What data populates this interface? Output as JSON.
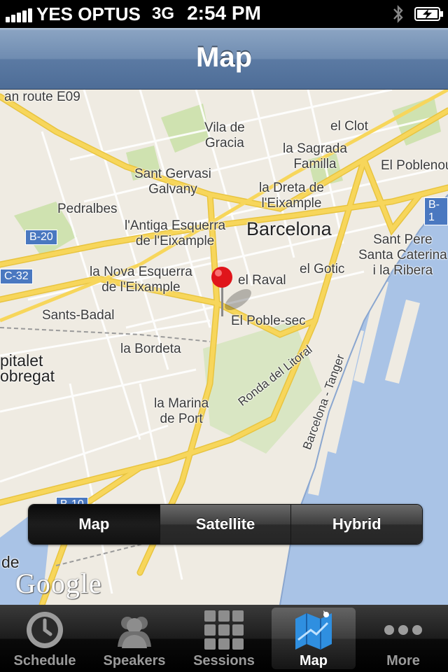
{
  "status_bar": {
    "carrier": "YES OPTUS",
    "network": "3G",
    "time": "2:54 PM",
    "icons": [
      "signal-icon",
      "bluetooth-icon",
      "battery-charging-icon"
    ]
  },
  "nav_bar": {
    "title": "Map"
  },
  "map": {
    "labels": {
      "vila_de_gracia": "Vila de\nGracia",
      "el_clot": "el Clot",
      "la_sagrada_familia": "la Sagrada\nFamilla",
      "el_poblenou": "El Poblenou",
      "sant_gervasi": "Sant Gervasi\nGalvany",
      "la_dreta": "la Dreta de\nl'Eixample",
      "pedralbes": "Pedralbes",
      "antiga_esquerra": "l'Antiga Esquerra\nde l'Eixample",
      "barcelona": "Barcelona",
      "sant_pere": "Sant Pere\nSanta Caterina\ni la Ribera",
      "nova_esquerra": "la Nova Esquerra\nde l'Eixample",
      "el_raval": "el Raval",
      "el_gotic": "el Gotic",
      "sants_badal": "Sants-Badal",
      "el_poble_sec": "El Poble-sec",
      "la_bordeta": "la Bordeta",
      "hospitalet": "pitalet\nobregat",
      "la_marina": "la Marina\nde Port",
      "ronda_litoral": "Ronda del Litoral",
      "barcelona_tanger": "Barcelona - Tanger",
      "route_e09": "an route E09",
      "de": "de"
    },
    "shields": {
      "b20": "B-20",
      "c32": "C-32",
      "b10": "B-10",
      "b1": "B-1"
    },
    "attribution": "Google",
    "pin_icon": "map-pin-icon"
  },
  "segmented_control": {
    "options": [
      "Map",
      "Satellite",
      "Hybrid"
    ],
    "selected": "Map"
  },
  "tab_bar": {
    "tabs": [
      {
        "label": "Schedule",
        "icon": "clock-icon"
      },
      {
        "label": "Speakers",
        "icon": "people-icon"
      },
      {
        "label": "Sessions",
        "icon": "grid-icon"
      },
      {
        "label": "Map",
        "icon": "map-icon"
      },
      {
        "label": "More",
        "icon": "more-dots-icon"
      }
    ],
    "active": "Map"
  },
  "colors": {
    "nav_bar": "#6f8cb1",
    "map_land": "#efebe2",
    "water": "#a9c3e6",
    "road_major": "#f7d65b",
    "park": "#cfe2b0",
    "pin": "#e0151b"
  }
}
